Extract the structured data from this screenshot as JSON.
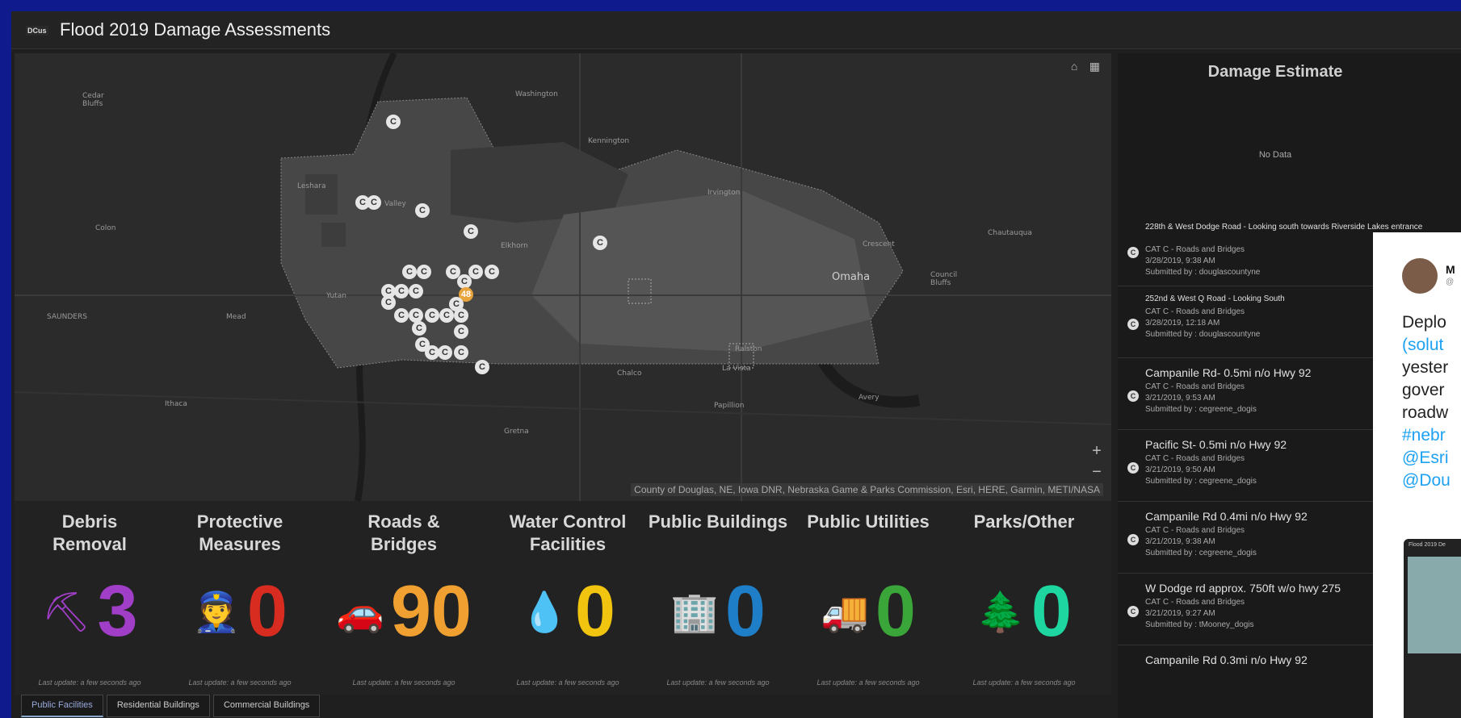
{
  "app": {
    "logo": "DCus",
    "title": "Flood 2019 Damage Assessments"
  },
  "map": {
    "places": [
      {
        "name": "Cedar Bluffs"
      },
      {
        "name": "Washington"
      },
      {
        "name": "Kennington"
      },
      {
        "name": "Leshara"
      },
      {
        "name": "Valley"
      },
      {
        "name": "Irvington"
      },
      {
        "name": "Colon"
      },
      {
        "name": "Elkhorn"
      },
      {
        "name": "Omaha"
      },
      {
        "name": "Council Bluffs"
      },
      {
        "name": "Crescent"
      },
      {
        "name": "Yutan"
      },
      {
        "name": "Mead"
      },
      {
        "name": "Gretna"
      },
      {
        "name": "Papillion"
      },
      {
        "name": "Chalco"
      },
      {
        "name": "La Vista"
      },
      {
        "name": "Ralston"
      },
      {
        "name": "Ithaca"
      },
      {
        "name": "Avery"
      },
      {
        "name": "Chautauqua"
      },
      {
        "name": "SAUNDERS"
      }
    ],
    "attribution": "County of Douglas, NE, Iowa DNR, Nebraska Game & Parks Commission, Esri, HERE, Garmin, METI/NASA",
    "tools": {
      "home": "⌂",
      "grid": "▦"
    },
    "zoom_in": "+",
    "zoom_out": "−",
    "marker_label": "C",
    "orange_marker_label": "48"
  },
  "stats": [
    {
      "label": "Debris\nRemoval",
      "value": "3",
      "icon": "person-shovel-icon",
      "glyph": "⛏",
      "color": "#a03ec7",
      "foot": "Last update: a few seconds ago"
    },
    {
      "label": "Protective\nMeasures",
      "value": "0",
      "icon": "police-icon",
      "glyph": "👮",
      "color": "#d82c20",
      "foot": "Last update: a few seconds ago"
    },
    {
      "label": "Roads &\nBridges",
      "value": "90",
      "icon": "car-icon",
      "glyph": "🚗",
      "color": "#f0a030",
      "foot": "Last update: a few seconds ago"
    },
    {
      "label": "Water Control\nFacilities",
      "value": "0",
      "icon": "water-drop-icon",
      "glyph": "💧",
      "color": "#f1c40f",
      "foot": "Last update: a few seconds ago"
    },
    {
      "label": "Public Buildings",
      "value": "0",
      "icon": "building-icon",
      "glyph": "🏢",
      "color": "#1e7ec8",
      "foot": "Last update: a few seconds ago"
    },
    {
      "label": "Public Utilities",
      "value": "0",
      "icon": "truck-icon",
      "glyph": "🚚",
      "color": "#3aa63a",
      "foot": "Last update: a few seconds ago"
    },
    {
      "label": "Parks/Other",
      "value": "0",
      "icon": "tree-icon",
      "glyph": "🌲",
      "color": "#1dd6a0",
      "foot": "Last update: a few seconds ago"
    }
  ],
  "tabs": [
    "Public Facilities",
    "Residential Buildings",
    "Commercial Buildings"
  ],
  "side": {
    "title": "Damage Estimate",
    "no_data": "No Data",
    "items": [
      {
        "title": "228th & West Dodge Road - Looking south towards Riverside Lakes entrance",
        "cat": "CAT C - Roads and Bridges",
        "date": "3/28/2019, 9:38 AM",
        "by": "Submitted by : douglascountyne"
      },
      {
        "title": "252nd & West Q Road - Looking South",
        "cat": "CAT C - Roads and Bridges",
        "date": "3/28/2019, 12:18 AM",
        "by": "Submitted by : douglascountyne"
      },
      {
        "title": "Campanile Rd- 0.5mi n/o Hwy 92",
        "cat": "CAT C - Roads and Bridges",
        "date": "3/21/2019, 9:53 AM",
        "by": "Submitted by : cegreene_dogis"
      },
      {
        "title": "Pacific St- 0.5mi n/o Hwy 92",
        "cat": "CAT C - Roads and Bridges",
        "date": "3/21/2019, 9:50 AM",
        "by": "Submitted by : cegreene_dogis"
      },
      {
        "title": "Campanile Rd 0.4mi n/o Hwy 92",
        "cat": "CAT C - Roads and Bridges",
        "date": "3/21/2019, 9:38 AM",
        "by": "Submitted by : cegreene_dogis"
      },
      {
        "title": "W Dodge rd approx. 750ft w/o hwy 275",
        "cat": "CAT C - Roads and Bridges",
        "date": "3/21/2019, 9:27 AM",
        "by": "Submitted by : tMooney_dogis"
      },
      {
        "title": "Campanile Rd 0.3mi n/o Hwy 92",
        "cat": "",
        "date": "",
        "by": ""
      }
    ]
  },
  "tweet": {
    "name": "M",
    "handle": "@",
    "lines": [
      "Deplo",
      "(solut",
      "yester",
      "gover",
      "roadw",
      "#nebr",
      "@Esri",
      "@Dou"
    ],
    "thumb_caption": "Flood 2019 De"
  }
}
